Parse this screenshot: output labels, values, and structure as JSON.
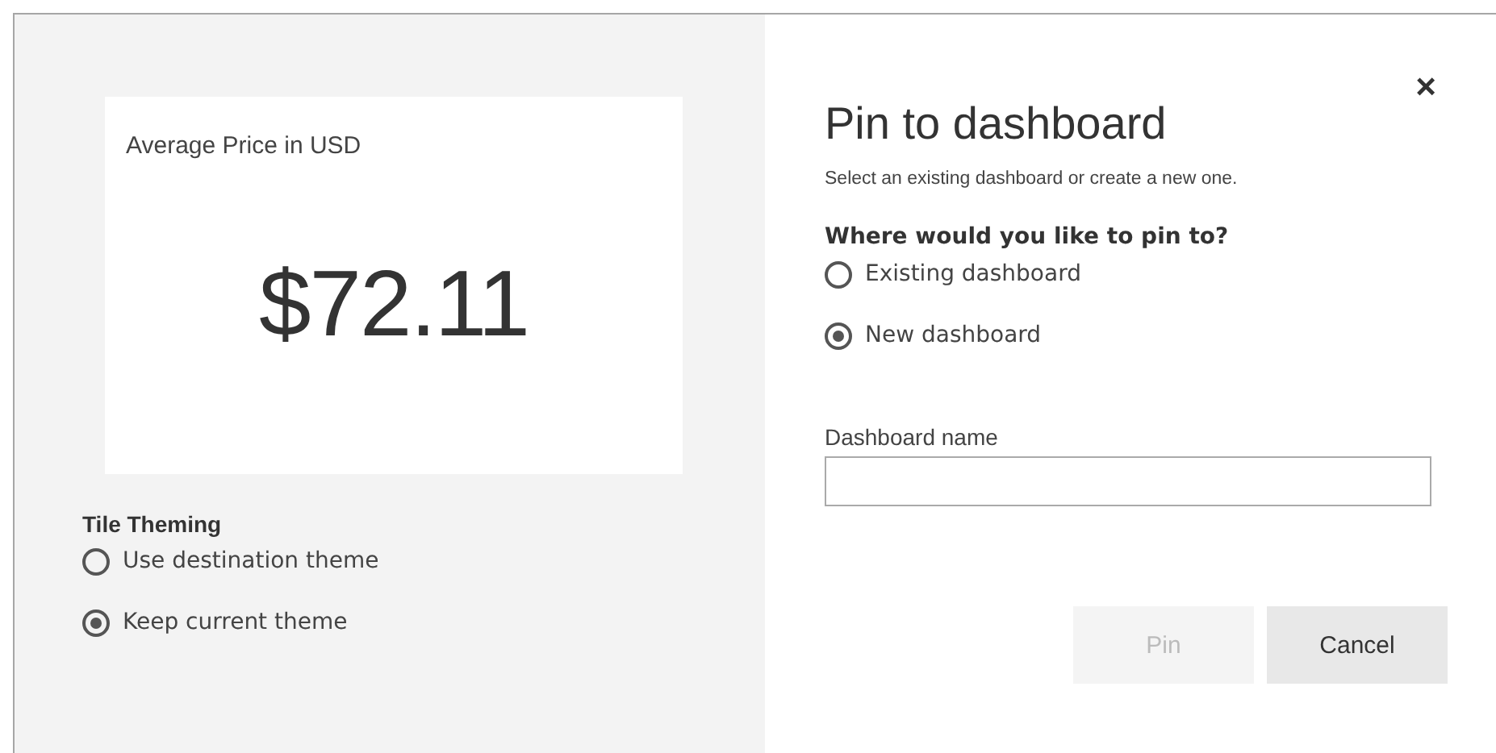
{
  "tile": {
    "title": "Average Price in USD",
    "value": "$72.11"
  },
  "tile_theming": {
    "label": "Tile Theming",
    "options": [
      {
        "label": "Use destination theme",
        "selected": false
      },
      {
        "label": "Keep current theme",
        "selected": true
      }
    ]
  },
  "dialog": {
    "title": "Pin to dashboard",
    "close": "×",
    "subtitle": "Select an existing dashboard or create a new one.",
    "question": "Where would you like to pin to?",
    "options": [
      {
        "label": "Existing dashboard",
        "selected": false
      },
      {
        "label": "New dashboard",
        "selected": true
      }
    ],
    "name_field": {
      "label": "Dashboard name"
    },
    "buttons": [
      {
        "label": "Pin",
        "disabled": true
      },
      {
        "label": "Cancel",
        "disabled": false
      }
    ]
  }
}
